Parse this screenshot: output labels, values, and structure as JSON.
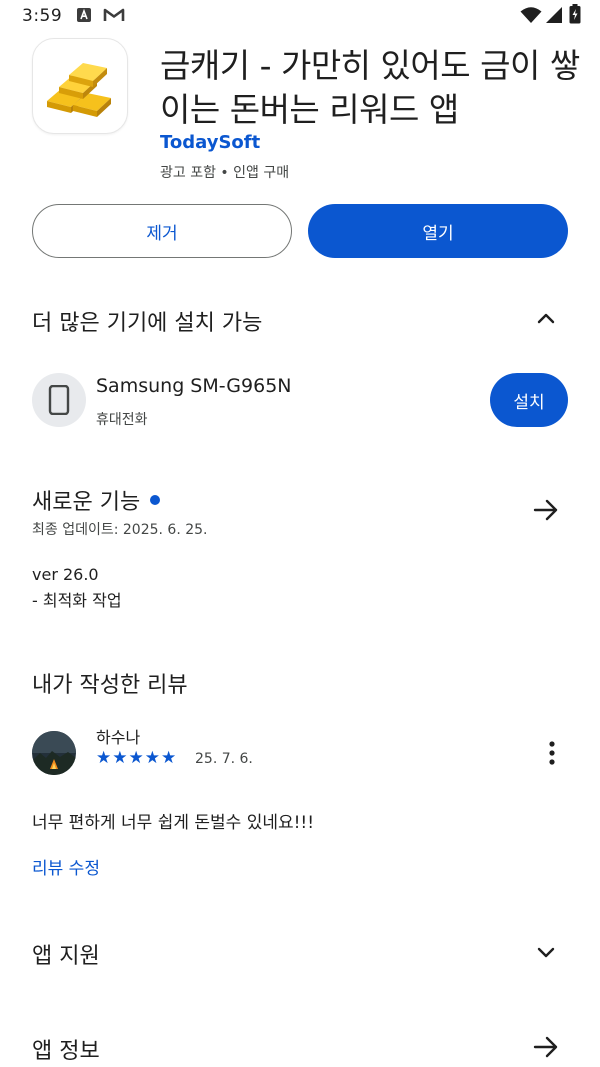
{
  "status_bar": {
    "time": "3:59",
    "left_icons": [
      "a-badge-icon",
      "gmail-icon"
    ],
    "right_icons": [
      "wifi-icon",
      "signal-icon",
      "battery-icon"
    ]
  },
  "app": {
    "title": "금캐기 - 가만히 있어도 금이 쌓이는 돈버는 리워드 앱",
    "developer": "TodaySoft",
    "meta": "광고 포함 • 인앱 구매",
    "icon": "gold-bars-icon"
  },
  "actions": {
    "uninstall_label": "제거",
    "open_label": "열기"
  },
  "more_devices": {
    "title": "더 많은 기기에 설치 가능",
    "device_name": "Samsung SM-G965N",
    "device_type": "휴대전화",
    "install_label": "설치"
  },
  "whats_new": {
    "title": "새로운 기능",
    "updated": "최종 업데이트: 2025. 6. 25.",
    "version": "ver 26.0",
    "notes": "- 최적화 작업"
  },
  "my_review": {
    "title": "내가 작성한 리뷰",
    "reviewer": "하수나",
    "rating": 5,
    "stars": "★★★★★",
    "date": "25. 7. 6.",
    "text": "너무 편하게 너무 쉽게 돈벌수 있네요!!!",
    "edit_label": "리뷰 수정"
  },
  "app_support": {
    "title": "앱 지원"
  },
  "app_info": {
    "title": "앱 정보"
  },
  "colors": {
    "accent": "#0b57d0",
    "text": "#1f1f1f",
    "secondary_text": "#444746"
  }
}
